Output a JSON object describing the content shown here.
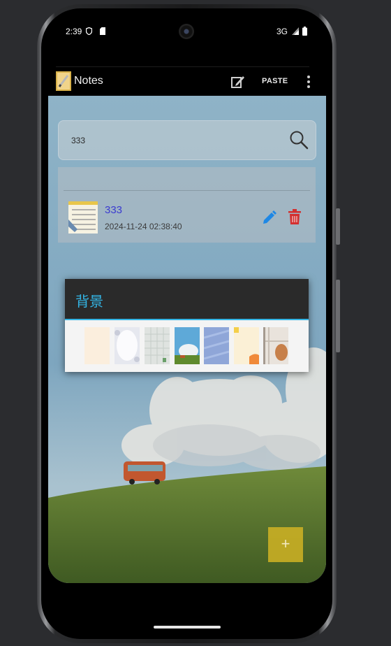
{
  "status": {
    "time": "2:39",
    "network": "3G"
  },
  "actionbar": {
    "title": "Notes",
    "paste_label": "PASTE",
    "icons": [
      "app-logo-icon",
      "edit-note-icon",
      "overflow-menu-icon"
    ]
  },
  "search": {
    "value": "333"
  },
  "notes": [
    {
      "title": "333",
      "date": "2024-11-24 02:38:40"
    }
  ],
  "dialog": {
    "title": "背景",
    "swatches": [
      "cream",
      "white-lace",
      "light-gray-pattern",
      "sky-grass",
      "blue-texture",
      "yellow-orange",
      "window-plant"
    ]
  },
  "fab": {
    "label": "+"
  },
  "colors": {
    "accent": "#33b5e5",
    "note_title": "#3b3bd0",
    "delete": "#d32f2f",
    "edit": "#1e88e5",
    "fab": "#d6b623"
  }
}
